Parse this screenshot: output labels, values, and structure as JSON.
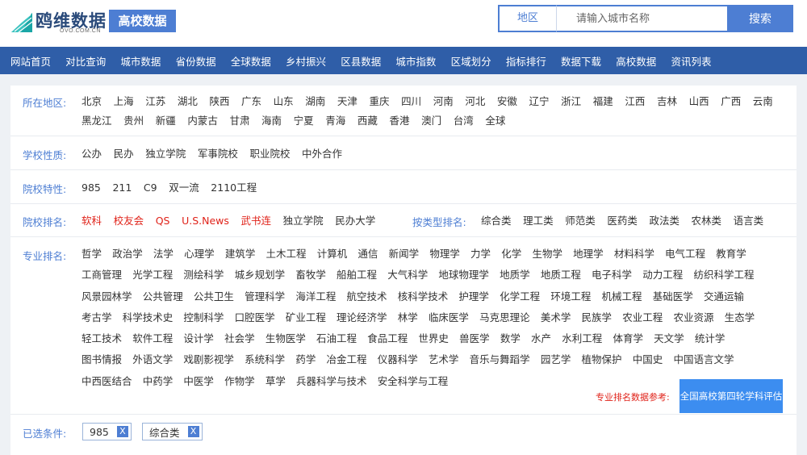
{
  "header": {
    "logo_text": "鸥维数据",
    "logo_sub": "OVO.COM.CN",
    "tag": "高校数据",
    "search": {
      "region": "地区",
      "placeholder": "请输入城市名称",
      "button": "搜索"
    }
  },
  "nav": [
    "网站首页",
    "对比查询",
    "城市数据",
    "省份数据",
    "全球数据",
    "乡村振兴",
    "区县数据",
    "城市指数",
    "区域划分",
    "指标排行",
    "数据下载",
    "高校数据",
    "资讯列表"
  ],
  "filters": {
    "region": {
      "label": "所在地区:",
      "options": [
        "北京",
        "上海",
        "江苏",
        "湖北",
        "陕西",
        "广东",
        "山东",
        "湖南",
        "天津",
        "重庆",
        "四川",
        "河南",
        "河北",
        "安徽",
        "辽宁",
        "浙江",
        "福建",
        "江西",
        "吉林",
        "山西",
        "广西",
        "云南",
        "黑龙江",
        "贵州",
        "新疆",
        "内蒙古",
        "甘肃",
        "海南",
        "宁夏",
        "青海",
        "西藏",
        "香港",
        "澳门",
        "台湾",
        "全球"
      ]
    },
    "nature": {
      "label": "学校性质:",
      "options": [
        "公办",
        "民办",
        "独立学院",
        "军事院校",
        "职业院校",
        "中外合作"
      ]
    },
    "feature": {
      "label": "院校特性:",
      "options": [
        "985",
        "211",
        "C9",
        "双一流",
        "2110工程"
      ]
    },
    "ranking": {
      "label": "院校排名:",
      "options": [
        "软科",
        "校友会",
        "QS",
        "U.S.News",
        "武书连",
        "独立学院",
        "民办大学"
      ],
      "red_count": 5
    },
    "type_ranking": {
      "label": "按类型排名:",
      "options": [
        "综合类",
        "理工类",
        "师范类",
        "医药类",
        "政法类",
        "农林类",
        "语言类"
      ]
    },
    "major_ranking": {
      "label": "专业排名:",
      "rows": [
        [
          "哲学",
          "政治学",
          "法学",
          "心理学",
          "建筑学",
          "土木工程",
          "计算机",
          "通信",
          "新闻学",
          "物理学",
          "力学",
          "化学",
          "生物学",
          "地理学",
          "材料科学",
          "电气工程",
          "教育学"
        ],
        [
          "工商管理",
          "光学工程",
          "测绘科学",
          "城乡规划学",
          "畜牧学",
          "船舶工程",
          "大气科学",
          "地球物理学",
          "地质学",
          "地质工程",
          "电子科学",
          "动力工程",
          "纺织科学工程"
        ],
        [
          "风景园林学",
          "公共管理",
          "公共卫生",
          "管理科学",
          "海洋工程",
          "航空技术",
          "核科学技术",
          "护理学",
          "化学工程",
          "环境工程",
          "机械工程",
          "基础医学",
          "交通运输"
        ],
        [
          "考古学",
          "科学技术史",
          "控制科学",
          "口腔医学",
          "矿业工程",
          "理论经济学",
          "林学",
          "临床医学",
          "马克思理论",
          "美术学",
          "民族学",
          "农业工程",
          "农业资源",
          "生态学"
        ],
        [
          "轻工技术",
          "软件工程",
          "设计学",
          "社会学",
          "生物医学",
          "石油工程",
          "食品工程",
          "世界史",
          "兽医学",
          "数学",
          "水产",
          "水利工程",
          "体育学",
          "天文学",
          "统计学"
        ],
        [
          "图书情报",
          "外语文学",
          "戏剧影视学",
          "系统科学",
          "药学",
          "冶金工程",
          "仪器科学",
          "艺术学",
          "音乐与舞蹈学",
          "园艺学",
          "植物保护",
          "中国史",
          "中国语言文学"
        ],
        [
          "中西医结合",
          "中药学",
          "中医学",
          "作物学",
          "草学",
          "兵器科学与技术",
          "安全科学与工程"
        ]
      ],
      "note": "专业排名数据参考:",
      "note_button": "全国高校第四轮学科评估"
    },
    "selected": {
      "label": "已选条件:",
      "chips": [
        "985",
        "综合类"
      ],
      "remove_symbol": "X"
    }
  }
}
